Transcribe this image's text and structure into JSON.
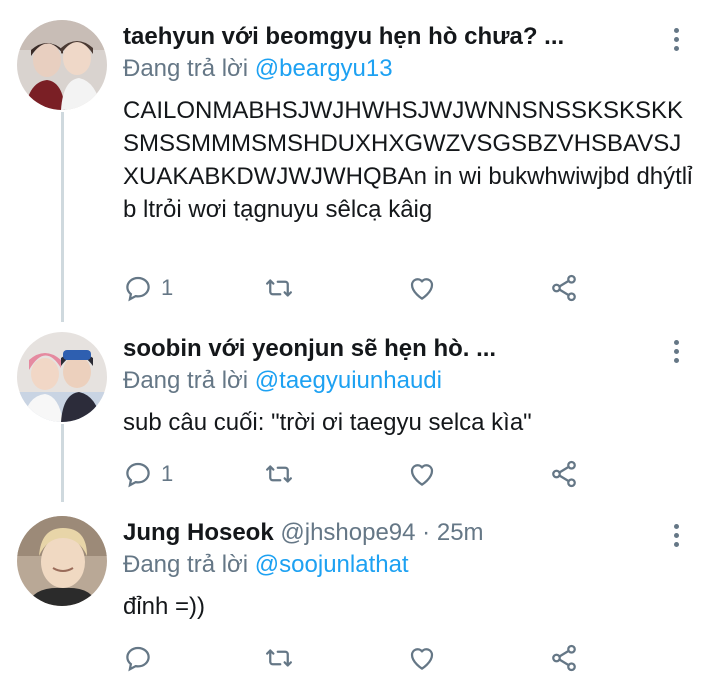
{
  "tweets": [
    {
      "name": "taehyun với beomgyu hẹn hò chưa? ...",
      "handle": "",
      "time": "",
      "reply_prefix": "Đang trả lời ",
      "reply_mention": "@beargyu13",
      "text": "CAILONMABHSJWJHWHSJWJWNNSNSSKSKSKKSMSSMMMSMSHDUXHXGWZVSGSBZVHSBAVSJXUAKABKDWJWJWHQBAn in wi bukwhwiwjbd dhýtlỉb ltrỏi wơi tạgnuyu sêlcạ kâig",
      "reply_count": "1",
      "retweet_count": "",
      "like_count": ""
    },
    {
      "name": "soobin với yeonjun sẽ hẹn hò. ...",
      "handle": "",
      "time": "",
      "reply_prefix": "Đang trả lời ",
      "reply_mention": "@taegyuiunhaudi",
      "text": "sub câu cuối: \"trời ơi taegyu selca kìa\"",
      "reply_count": "1",
      "retweet_count": "",
      "like_count": ""
    },
    {
      "name": "Jung Hoseok",
      "handle": "@jhshope94",
      "separator": " · ",
      "time": "25m",
      "reply_prefix": "Đang trả lời ",
      "reply_mention": "@soojunlathat",
      "text": "đỉnh =))",
      "reply_count": "",
      "retweet_count": "",
      "like_count": ""
    }
  ],
  "icons": {
    "reply": "reply-icon",
    "retweet": "retweet-icon",
    "like": "heart-icon",
    "share": "share-icon",
    "more": "more-vertical-icon"
  },
  "colors": {
    "link": "#1da1f2",
    "muted": "#657786",
    "text": "#14171a",
    "thread_line": "#cfd9de"
  }
}
